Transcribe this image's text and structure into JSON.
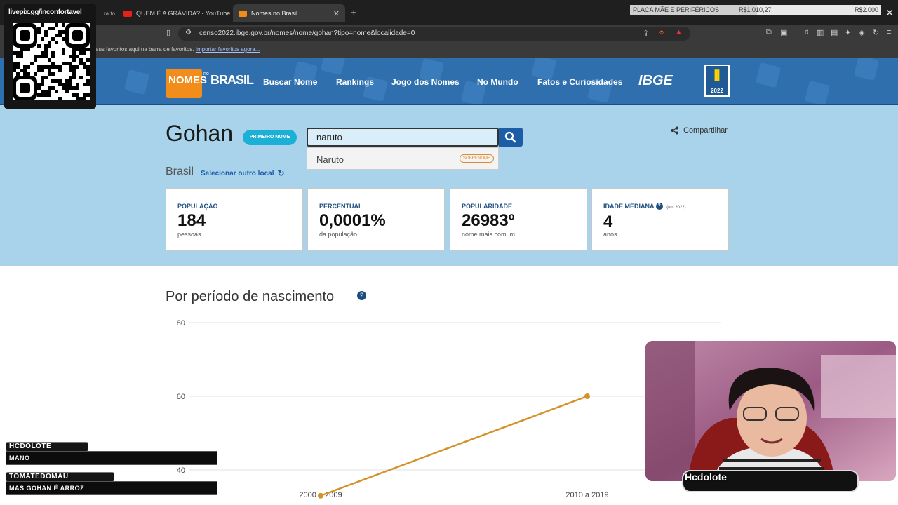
{
  "browser": {
    "tabs": [
      {
        "label": "livepix.gg/inconfortavel"
      },
      {
        "label": "QUEM É A GRÁVIDA? - YouTube"
      },
      {
        "label": "Nomes no Brasil"
      }
    ],
    "donation": {
      "label": "PLACA MÃE E PERIFÉRICOS",
      "current": "R$1.010,27",
      "goal": "R$2.000",
      "progress": 0.505
    },
    "url": "censo2022.ibge.gov.br/nomes/nome/gohan?tipo=nome&localidade=0",
    "bookmarks_text": "eus favoritos aqui na barra de favoritos.",
    "bookmarks_link": "Importar favoritos agora..."
  },
  "site": {
    "logo_main": "NOMES",
    "logo_no": "no",
    "logo_brasil": "BRASIL",
    "nav": [
      "Buscar Nome",
      "Rankings",
      "Jogo dos Nomes",
      "No Mundo",
      "Fatos e Curiosidades"
    ],
    "ibge": "IBGE",
    "censo_year": "2022"
  },
  "name": {
    "title": "Gohan",
    "badge": "PRIMEIRO NOME",
    "location": "Brasil",
    "change_location": "Selecionar outro local",
    "share": "Compartilhar"
  },
  "search": {
    "value": "naruto",
    "suggestion": "Naruto",
    "suggestion_tag": "SOBRENOME"
  },
  "stats": [
    {
      "label": "POPULAÇÃO",
      "value": "184",
      "sub": "pessoas"
    },
    {
      "label": "PERCENTUAL",
      "value": "0,0001%",
      "sub": "da população"
    },
    {
      "label": "POPULARIDADE",
      "value": "26983º",
      "sub": "nome mais comum"
    },
    {
      "label": "IDADE MEDIANA",
      "value": "4",
      "sub": "anos",
      "help": "?",
      "note": "(em 2022)"
    }
  ],
  "chart": {
    "title": "Por período de nascimento",
    "help": "?"
  },
  "chart_data": {
    "type": "line",
    "categories": [
      "2000 a 2009",
      "2010 a 2019"
    ],
    "series": [
      {
        "values": [
          33,
          60
        ]
      }
    ],
    "yticks": [
      40,
      60,
      80
    ],
    "ylim": [
      20,
      80
    ],
    "color": "#d4922a",
    "grid": true
  },
  "overlay": {
    "qr_label": "livepix.gg/inconfortavel",
    "chat": [
      {
        "user": "HCDOLOTE",
        "message": "MANO"
      },
      {
        "user": "TOMATEDOMAU",
        "message": "MAS GOHAN É ARROZ"
      }
    ],
    "cam_name": "Hcdolote"
  }
}
